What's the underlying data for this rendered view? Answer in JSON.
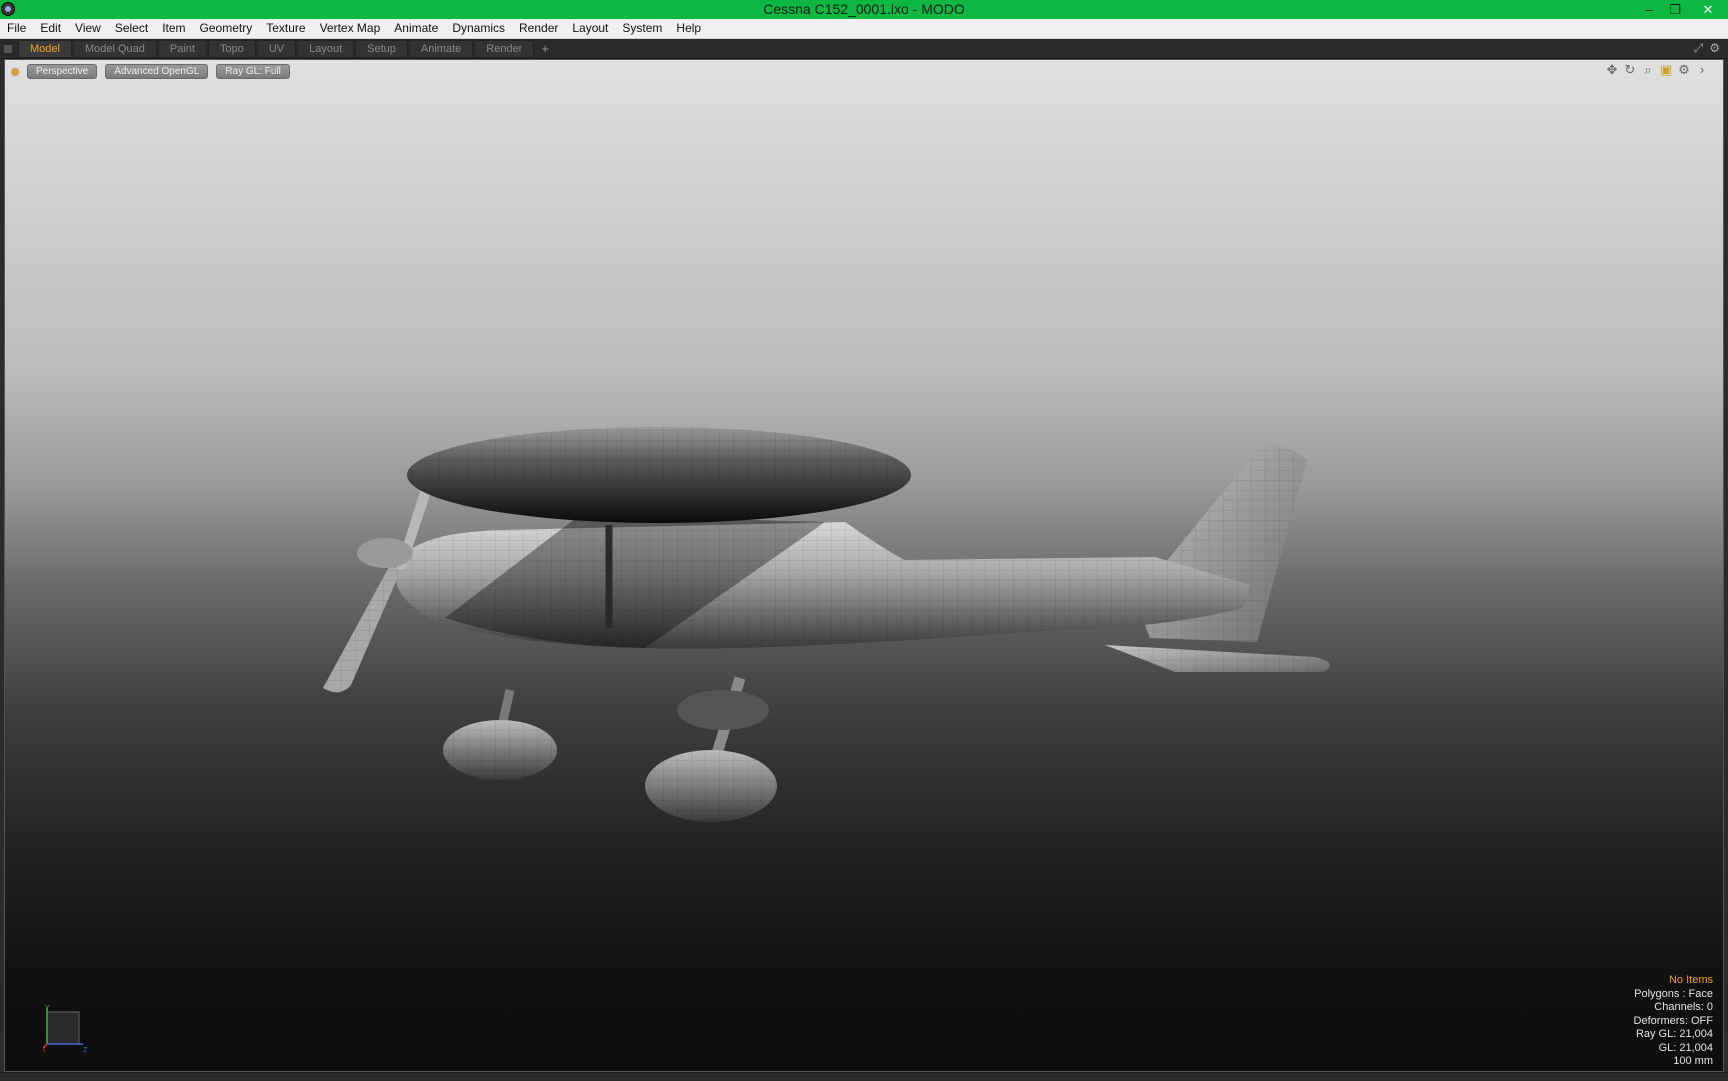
{
  "window": {
    "title": "Cessna C152_0001.lxo - MODO",
    "minimize": "–",
    "restore": "❐",
    "close": "✕"
  },
  "menu": [
    "File",
    "Edit",
    "View",
    "Select",
    "Item",
    "Geometry",
    "Texture",
    "Vertex Map",
    "Animate",
    "Dynamics",
    "Render",
    "Layout",
    "System",
    "Help"
  ],
  "tabs": {
    "items": [
      "Model",
      "Model Quad",
      "Paint",
      "Topo",
      "UV",
      "Layout",
      "Setup",
      "Animate",
      "Render"
    ],
    "active": "Model",
    "add": "+"
  },
  "viewport": {
    "view_mode": "Perspective",
    "shading": "Advanced OpenGL",
    "ray_gl": "Ray GL: Full"
  },
  "axes": {
    "x": "X",
    "y": "Y",
    "z": "Z"
  },
  "info": {
    "selection": "No Items",
    "polygons": "Polygons : Face",
    "channels": "Channels: 0",
    "deformers": "Deformers: OFF",
    "ray_gl": "Ray GL: 21,004",
    "gl": "GL: 21,004",
    "grid": "100 mm"
  },
  "colors": {
    "titlebar": "#0cb842",
    "active_tab": "#f0a020",
    "info_highlight": "#f0a020"
  }
}
